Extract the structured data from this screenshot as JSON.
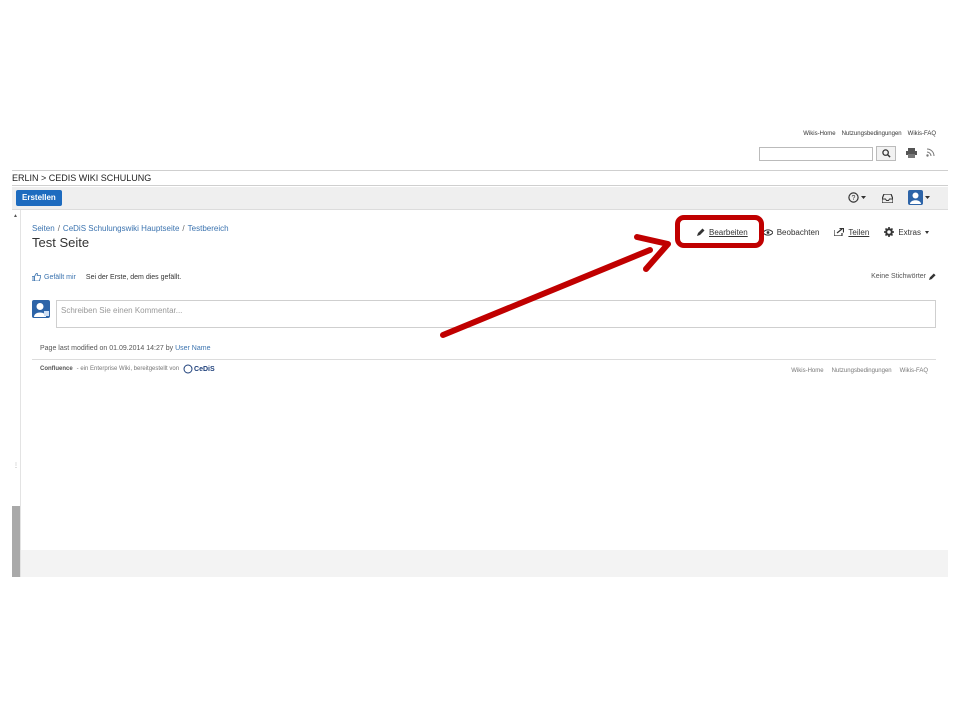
{
  "top_links": [
    "Wikis-Home",
    "Nutzungsbedingungen",
    "Wikis-FAQ"
  ],
  "search": {
    "value": "",
    "placeholder": ""
  },
  "breadcrumb_bar": "ERLIN > CEDIS WIKI SCHULUNG",
  "toolbar": {
    "create_label": "Erstellen"
  },
  "breadcrumbs": [
    "Seiten",
    "CeDiS Schulungswiki Hauptseite",
    "Testbereich"
  ],
  "page": {
    "title": "Test Seite"
  },
  "actions": {
    "edit": "Bearbeiten",
    "watch": "Beobachten",
    "share": "Teilen",
    "tools": "Extras"
  },
  "likes": {
    "like_label": "Gefällt mir",
    "text": "Sei der Erste, dem dies gefällt."
  },
  "labels": {
    "text": "Keine Stichwörter"
  },
  "comment": {
    "placeholder": "Schreiben Sie einen Kommentar..."
  },
  "modified": {
    "prefix": "Page last modified on 01.09.2014 14:27 by",
    "user": "User Name"
  },
  "footer": {
    "brand": "Confluence",
    "text": "- ein Enterprise Wiki, bereitgestellt von",
    "logo_text": "CeDiS",
    "links": [
      "Wikis-Home",
      "Nutzungsbedingungen",
      "Wikis-FAQ"
    ]
  },
  "colors": {
    "accent": "#1d6bbf",
    "link": "#3b73af",
    "annotation": "#c00000"
  }
}
